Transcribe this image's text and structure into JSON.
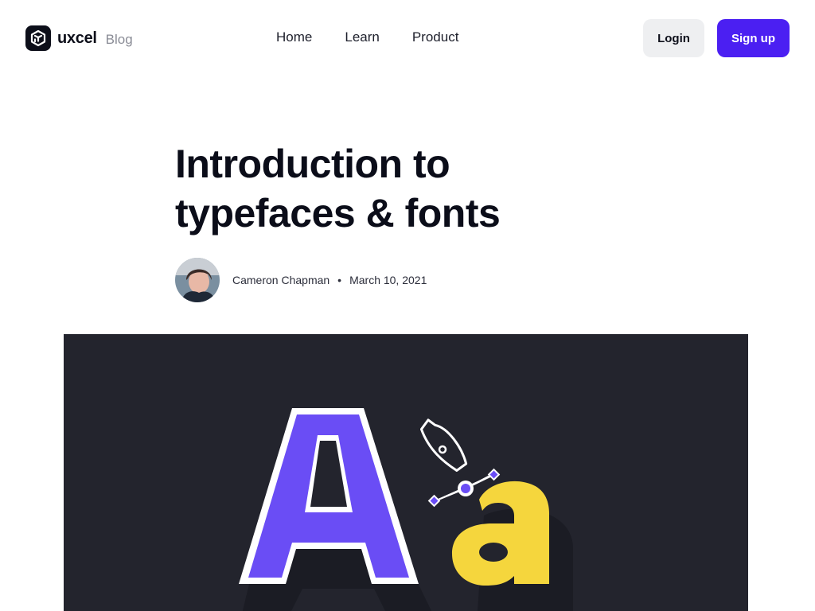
{
  "header": {
    "logo_text": "uxcel",
    "logo_suffix": "Blog",
    "nav": [
      {
        "label": "Home"
      },
      {
        "label": "Learn"
      },
      {
        "label": "Product"
      }
    ],
    "login_label": "Login",
    "signup_label": "Sign up"
  },
  "article": {
    "title_line1": "Introduction to",
    "title_line2": "typefaces & fonts",
    "author": "Cameron Chapman",
    "separator": "•",
    "date": "March 10, 2021"
  },
  "hero": {
    "big_letter": "A",
    "small_letter": "a"
  },
  "colors": {
    "brand": "#4b1ff2",
    "hero_bg": "#23242d",
    "letter_purple": "#6a4df5",
    "letter_yellow": "#f5d63d"
  }
}
